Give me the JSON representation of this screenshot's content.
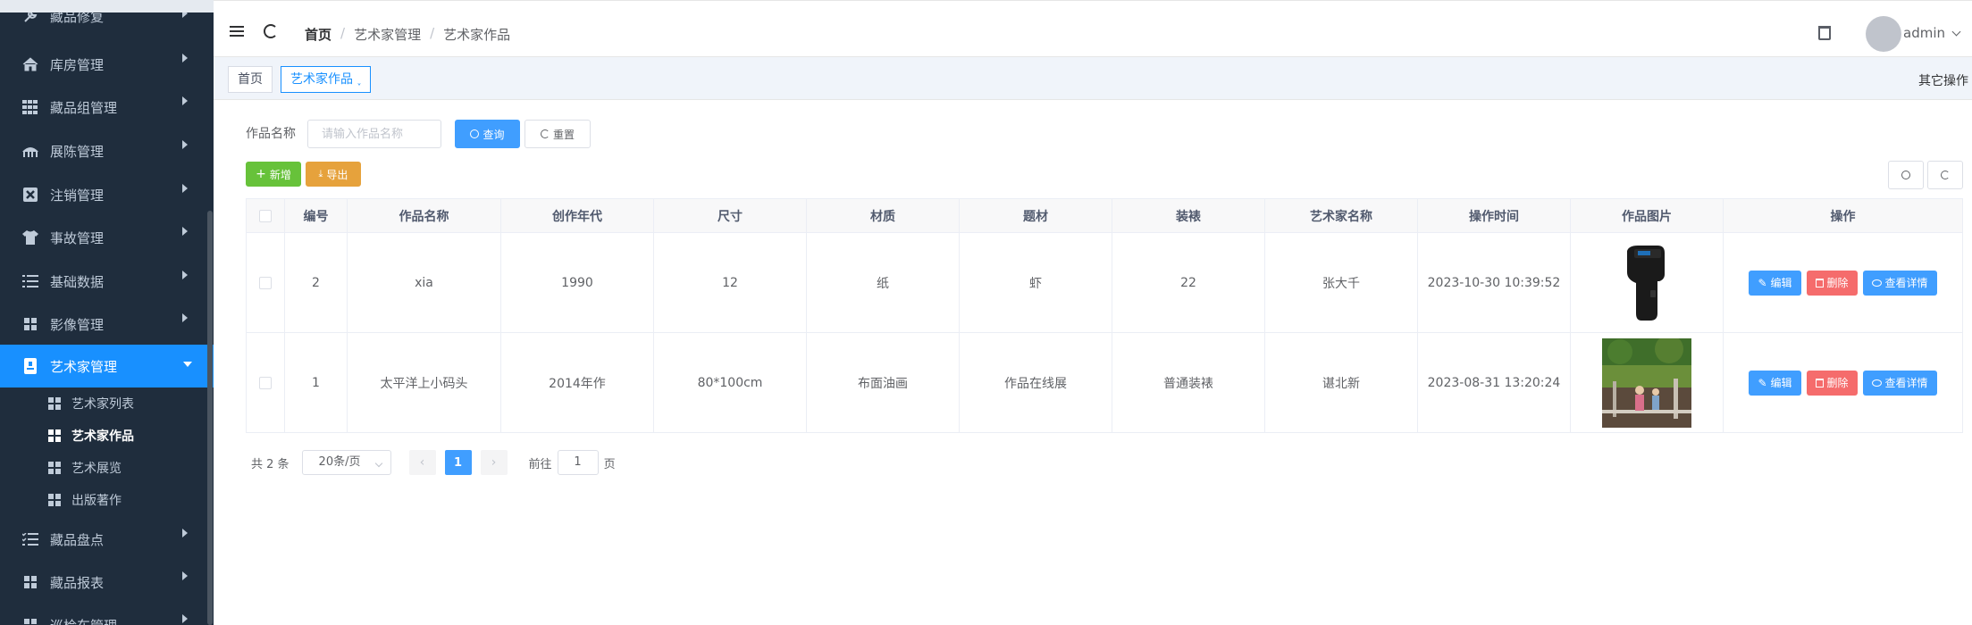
{
  "sidebar": {
    "items": [
      {
        "label": "藏品修复",
        "icon": "wrench-icon"
      },
      {
        "label": "库房管理",
        "icon": "home-icon"
      },
      {
        "label": "藏品组管理",
        "icon": "grid-icon"
      },
      {
        "label": "展陈管理",
        "icon": "exhibition-icon"
      },
      {
        "label": "注销管理",
        "icon": "cancel-box-icon"
      },
      {
        "label": "事故管理",
        "icon": "shirt-icon"
      },
      {
        "label": "基础数据",
        "icon": "list-icon"
      },
      {
        "label": "影像管理",
        "icon": "grid-icon"
      },
      {
        "label": "艺术家管理",
        "icon": "document-icon"
      },
      {
        "label": "藏品盘点",
        "icon": "checklist-icon"
      },
      {
        "label": "藏品报表",
        "icon": "grid-icon"
      },
      {
        "label": "巡检车管理",
        "icon": "grid-icon"
      }
    ],
    "subitems": [
      {
        "label": "艺术家列表"
      },
      {
        "label": "艺术家作品"
      },
      {
        "label": "艺术展览"
      },
      {
        "label": "出版著作"
      }
    ]
  },
  "header": {
    "breadcrumb": [
      "首页",
      "艺术家管理",
      "艺术家作品"
    ],
    "username": "admin"
  },
  "tags": {
    "home": "首页",
    "current": "艺术家作品",
    "current_suffix": "ˬ",
    "other_ops": "其它操作"
  },
  "search": {
    "label": "作品名称",
    "placeholder": "请输入作品名称",
    "query_label": "查询",
    "reset_label": "重置"
  },
  "toolbar": {
    "add_label": "新增",
    "export_label": "导出"
  },
  "table": {
    "headers": [
      "编号",
      "作品名称",
      "创作年代",
      "尺寸",
      "材质",
      "题材",
      "装裱",
      "艺术家名称",
      "操作时间",
      "作品图片",
      "操作"
    ],
    "rows": [
      {
        "id": "2",
        "name": "xia",
        "year": "1990",
        "size": "12",
        "material": "纸",
        "subject": "虾",
        "mount": "22",
        "artist": "张大千",
        "time": "2023-10-30 10:39:52",
        "image": "scanner-device"
      },
      {
        "id": "1",
        "name": "太平洋上小码头",
        "year": "2014年作",
        "size": "80*100cm",
        "material": "布面油画",
        "subject": "作品在线展",
        "mount": "普通装裱",
        "artist": "谌北新",
        "time": "2023-08-31 13:20:24",
        "image": "garden-photo"
      }
    ],
    "actions": {
      "edit": "编辑",
      "delete": "删除",
      "detail": "查看详情"
    }
  },
  "pagination": {
    "total_text": "共 2 条",
    "page_size": "20条/页",
    "current_page": "1",
    "goto_prefix": "前往",
    "goto_value": "1",
    "goto_suffix": "页"
  },
  "colors": {
    "sidebar_bg": "#1f2d3d",
    "accent": "#1890ff",
    "primary": "#409eff",
    "success": "#67c23a",
    "warning": "#e6a23c",
    "danger": "#f56c6c"
  }
}
